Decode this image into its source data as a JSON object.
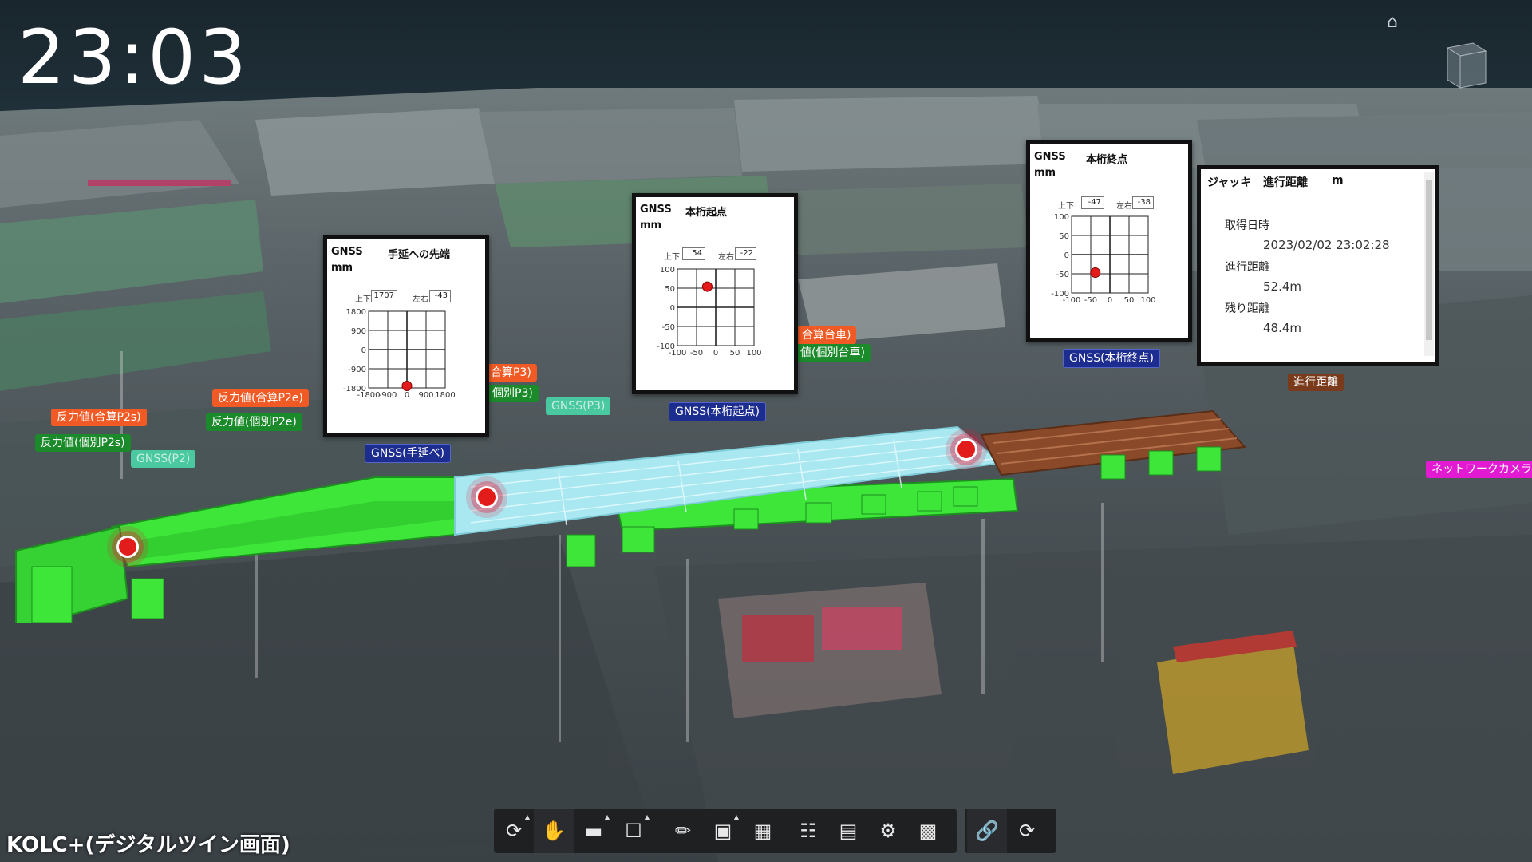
{
  "clock": "23:03",
  "caption": "KOLC+(デジタルツイン画面)",
  "tags": {
    "p2s_total": "反力値(合算P2s)",
    "p2s_indiv": "反力値(個別P2s)",
    "gnss_p2": "GNSS(P2)",
    "p2e_total": "反力値(合算P2e)",
    "p2e_indiv": "反力値(個別P2e)",
    "p3_total": "合算P3)",
    "p3_indiv": "個別P3)",
    "gnss_p3": "GNSS(P3)",
    "cart_total": "合算台車)",
    "cart_indiv": "値(個別台車)",
    "gnss_tenen": "GNSS(手延べ)",
    "gnss_start": "GNSS(本桁起点)",
    "gnss_end": "GNSS(本桁終点)",
    "jack_distance": "進行距離",
    "network_camera": "ネットワークカメラ"
  },
  "panels": {
    "tenen": {
      "source": "GNSS",
      "title": "手延への先端",
      "unit": "mm",
      "ud_label": "上下",
      "ud_value": "1707",
      "lr_label": "左右",
      "lr_value": "-43",
      "y_ticks": [
        "1800",
        "900",
        "0",
        "-900",
        "-1800"
      ],
      "x_ticks": [
        "-1800",
        "-900",
        "0",
        "900",
        "1800"
      ],
      "point": {
        "x": 0,
        "y": -1707
      },
      "range": 1800
    },
    "start": {
      "source": "GNSS",
      "title": "本桁起点",
      "unit": "mm",
      "ud_label": "上下",
      "ud_value": "54",
      "lr_label": "左右",
      "lr_value": "-22",
      "y_ticks": [
        "100",
        "50",
        "0",
        "-50",
        "-100"
      ],
      "x_ticks": [
        "-100",
        "-50",
        "0",
        "50",
        "100"
      ],
      "point": {
        "x": -22,
        "y": 54
      },
      "range": 100
    },
    "end": {
      "source": "GNSS",
      "title": "本桁終点",
      "unit": "mm",
      "ud_label": "上下",
      "ud_value": "-47",
      "lr_label": "左右",
      "lr_value": "-38",
      "y_ticks": [
        "100",
        "50",
        "0",
        "-50",
        "-100"
      ],
      "x_ticks": [
        "-100",
        "-50",
        "0",
        "50",
        "100"
      ],
      "point": {
        "x": -38,
        "y": -47
      },
      "range": 100
    }
  },
  "jack_panel": {
    "title": "ジャッキ",
    "subtitle": "進行距離",
    "unit": "m",
    "acquired_label": "取得日時",
    "acquired_value": "2023/02/02 23:02:28",
    "distance_label": "進行距離",
    "distance_value": "52.4m",
    "remaining_label": "残り距離",
    "remaining_value": "48.4m"
  },
  "toolbar": {
    "groups": [
      [
        "orbit-icon",
        "pan-hand-icon",
        "camera-icon",
        "zoom-region-icon"
      ],
      [
        "measure-ruler-icon",
        "section-box-icon",
        "explode-model-icon"
      ],
      [
        "model-tree-icon",
        "properties-icon",
        "settings-gear-icon",
        "fullscreen-icon"
      ],
      [
        "link-icon",
        "refresh-icon"
      ]
    ]
  },
  "colors": {
    "green_girder": "#3ee63a",
    "cyan_girder": "#a9e8f0",
    "brown_cart": "#8a4a2a",
    "marker_red": "#e21b1b"
  }
}
